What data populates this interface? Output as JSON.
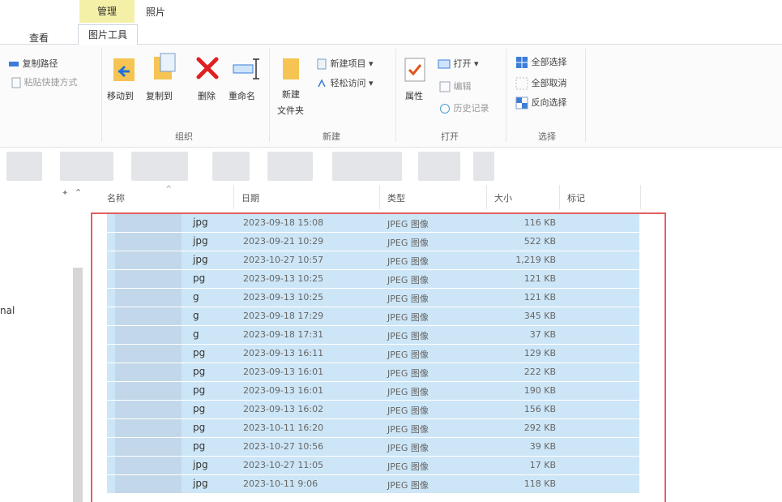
{
  "ribbon": {
    "tabs": {
      "manage": "管理",
      "photo": "照片",
      "view": "查看",
      "tools": "图片工具"
    },
    "clipboard": {
      "copy_path": "复制路径",
      "paste_shortcut": "粘贴快捷方式"
    },
    "organize": {
      "move_to": "移动到",
      "copy_to": "复制到",
      "delete": "删除",
      "rename": "重命名",
      "label": "组织"
    },
    "new": {
      "new_folder_l1": "新建",
      "new_folder_l2": "文件夹",
      "new_item": "新建项目 ▾",
      "easy_access": "轻松访问 ▾",
      "label": "新建"
    },
    "open": {
      "properties": "属性",
      "open": "打开 ▾",
      "edit": "编辑",
      "history": "历史记录",
      "label": "打开"
    },
    "select": {
      "select_all": "全部选择",
      "select_none": "全部取消",
      "invert": "反向选择",
      "label": "选择"
    }
  },
  "nav": {
    "partial_text": "nal"
  },
  "columns": {
    "name": "名称",
    "date": "日期",
    "type": "类型",
    "size": "大小",
    "tags": "标记"
  },
  "files": [
    {
      "ext": "jpg",
      "date": "2023-09-18 15:08",
      "type": "JPEG 图像",
      "size": "116 KB"
    },
    {
      "ext": "jpg",
      "date": "2023-09-21 10:29",
      "type": "JPEG 图像",
      "size": "522 KB"
    },
    {
      "ext": "jpg",
      "date": "2023-10-27 10:57",
      "type": "JPEG 图像",
      "size": "1,219 KB"
    },
    {
      "ext": "pg",
      "date": "2023-09-13 10:25",
      "type": "JPEG 图像",
      "size": "121 KB"
    },
    {
      "ext": "g",
      "date": "2023-09-13 10:25",
      "type": "JPEG 图像",
      "size": "121 KB"
    },
    {
      "ext": "g",
      "date": "2023-09-18 17:29",
      "type": "JPEG 图像",
      "size": "345 KB"
    },
    {
      "ext": "g",
      "date": "2023-09-18 17:31",
      "type": "JPEG 图像",
      "size": "37 KB"
    },
    {
      "ext": "pg",
      "date": "2023-09-13 16:11",
      "type": "JPEG 图像",
      "size": "129 KB"
    },
    {
      "ext": "pg",
      "date": "2023-09-13 16:01",
      "type": "JPEG 图像",
      "size": "222 KB"
    },
    {
      "ext": "pg",
      "date": "2023-09-13 16:01",
      "type": "JPEG 图像",
      "size": "190 KB"
    },
    {
      "ext": "pg",
      "date": "2023-09-13 16:02",
      "type": "JPEG 图像",
      "size": "156 KB"
    },
    {
      "ext": "pg",
      "date": "2023-10-11 16:20",
      "type": "JPEG 图像",
      "size": "292 KB"
    },
    {
      "ext": "pg",
      "date": "2023-10-27 10:56",
      "type": "JPEG 图像",
      "size": "39 KB"
    },
    {
      "ext": "jpg",
      "date": "2023-10-27 11:05",
      "type": "JPEG 图像",
      "size": "17 KB"
    },
    {
      "ext": "jpg",
      "date": "2023-10-11 9:06",
      "type": "JPEG 图像",
      "size": "118 KB"
    }
  ]
}
